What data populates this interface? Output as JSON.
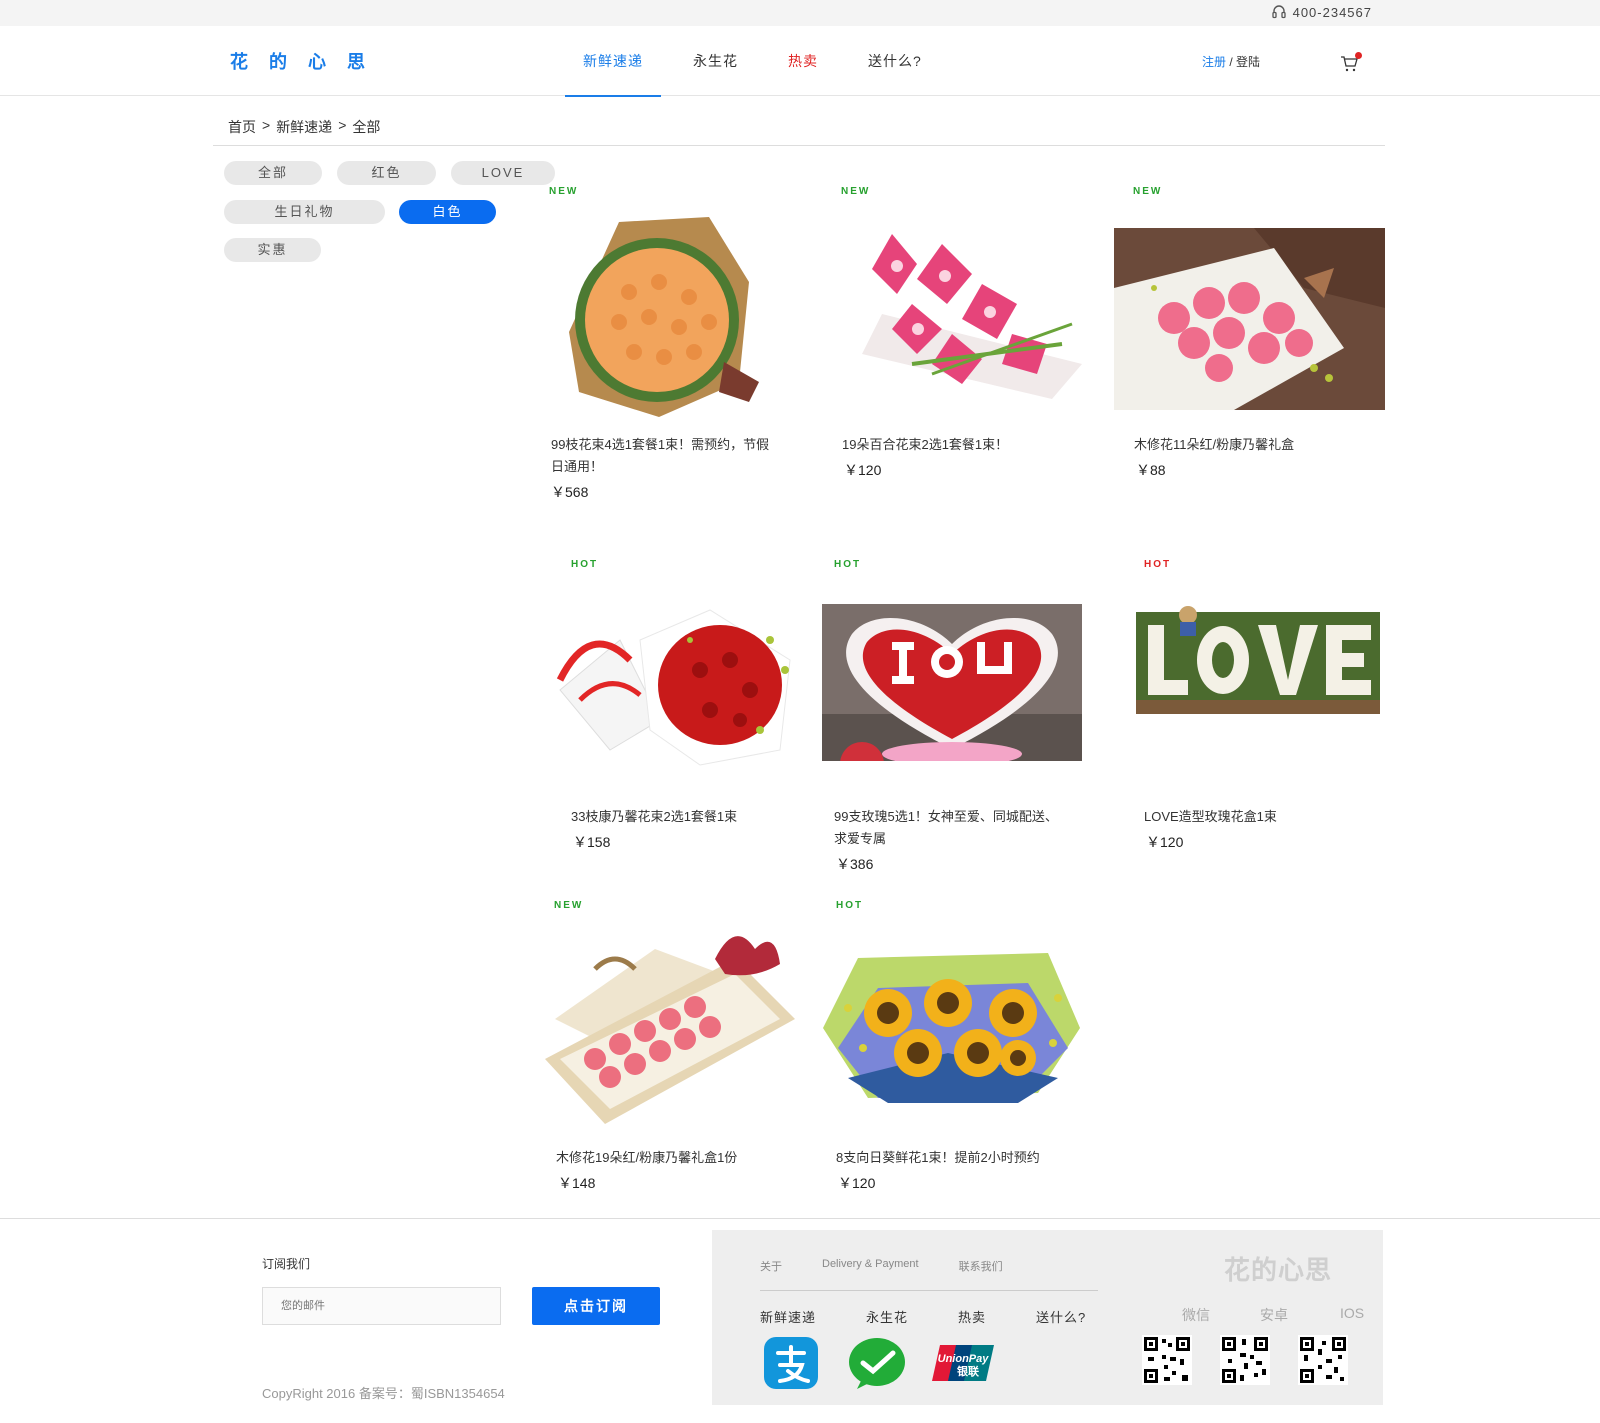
{
  "topbar": {
    "phone": "400-234567"
  },
  "header": {
    "logo": "花 的 心 思",
    "nav": [
      "新鲜速递",
      "永生花",
      "热卖",
      "送什么?"
    ],
    "register": "注册",
    "separator": " / ",
    "login": "登陆"
  },
  "breadcrumb": [
    "首页",
    ">",
    "新鲜速递",
    ">",
    "全部"
  ],
  "filters": [
    "全部",
    "红色",
    "LOVE",
    "生日礼物",
    "白色",
    "实惠"
  ],
  "products": [
    {
      "badge": "NEW",
      "name": "99枝花束4选1套餐1束！需预约，节假日通用！",
      "price": "￥568"
    },
    {
      "badge": "NEW",
      "name": "19朵百合花束2选1套餐1束！",
      "price": "￥120"
    },
    {
      "badge": "NEW",
      "name": "木修花11朵红/粉康乃馨礼盒",
      "price": "￥88"
    },
    {
      "badge": "HOT",
      "name": "33枝康乃馨花束2选1套餐1束",
      "price": "￥158"
    },
    {
      "badge": "HOT",
      "name": "99支玫瑰5选1！女神至爱、同城配送、求爱专属",
      "price": "￥386"
    },
    {
      "badge": "HOT",
      "name": "LOVE造型玫瑰花盒1束",
      "price": "￥120"
    },
    {
      "badge": "NEW",
      "name": "木修花19朵红/粉康乃馨礼盒1份",
      "price": "￥148"
    },
    {
      "badge": "HOT",
      "name": "8支向日葵鲜花1束！提前2小时预约",
      "price": "￥120"
    }
  ],
  "footer": {
    "subscribe_title": "订阅我们",
    "email_placeholder": "您的邮件",
    "subscribe_button": "点击订阅",
    "copyright": "CopyRight 2016 备案号：蜀ISBN1354654",
    "links": [
      "关于",
      "Delivery & Payment",
      "联系我们"
    ],
    "nav": [
      "新鲜速递",
      "永生花",
      "热卖",
      "送什么?"
    ],
    "logo": "花的心思",
    "apps": [
      "微信",
      "安卓",
      "IOS"
    ],
    "payments": [
      "支付宝",
      "微信支付",
      "UnionPay 银联"
    ],
    "unionpay_text": [
      "UnionPay",
      "银联"
    ]
  },
  "colors": {
    "accent": "#0a6cf0",
    "hot": "#e02424",
    "new": "#27a12f"
  }
}
